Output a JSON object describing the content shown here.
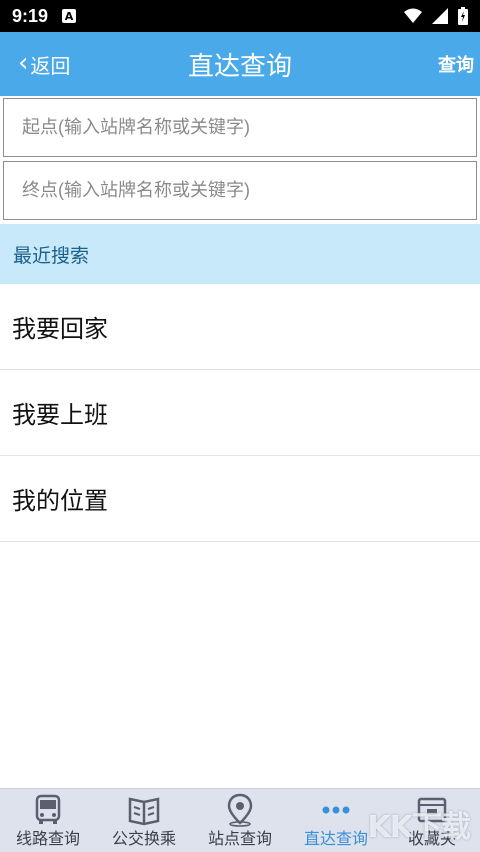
{
  "status": {
    "time": "9:19",
    "notif": "A"
  },
  "header": {
    "back_label": "返回",
    "title": "直达查询",
    "query_label": "查询"
  },
  "search": {
    "start_placeholder": "起点(输入站牌名称或关键字)",
    "end_placeholder": "终点(输入站牌名称或关键字)"
  },
  "recent": {
    "header": "最近搜索",
    "items": [
      "我要回家",
      "我要上班",
      "我的位置"
    ]
  },
  "tabs": [
    {
      "label": "线路查询",
      "icon": "bus-icon"
    },
    {
      "label": "公交换乘",
      "icon": "map-book-icon"
    },
    {
      "label": "站点查询",
      "icon": "location-pin-icon"
    },
    {
      "label": "直达查询",
      "icon": "dots-icon",
      "active": true
    },
    {
      "label": "收藏夹",
      "icon": "folder-icon"
    }
  ],
  "watermark": "KK下载",
  "colors": {
    "accent": "#4aa9e8",
    "recent_bg": "#c8e9fa",
    "tab_active": "#3b8fd6"
  }
}
